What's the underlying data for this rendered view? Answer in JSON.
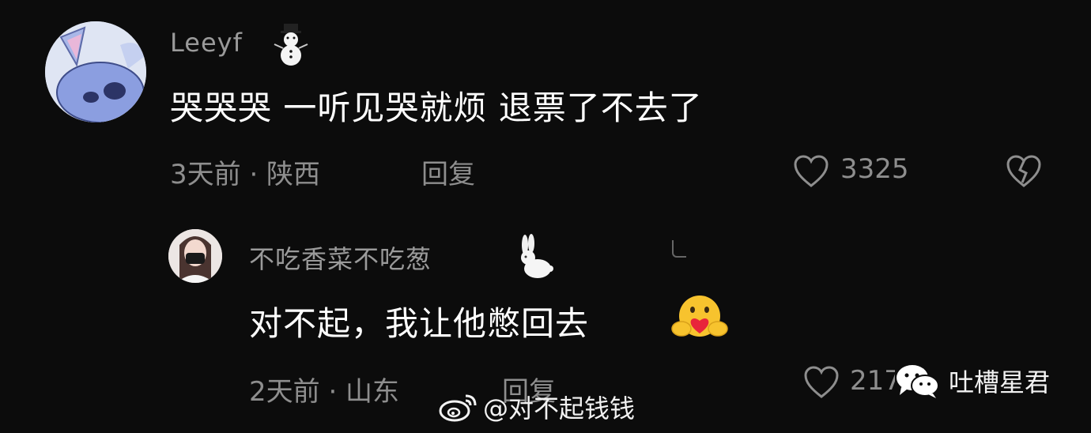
{
  "comment": {
    "username": "Leeyf",
    "username_emoji": "snowman-emoji",
    "text": "哭哭哭 一听见哭就烦 退票了不去了",
    "time": "3天前 · 陕西",
    "reply_label": "回复",
    "like_count": "3325"
  },
  "reply": {
    "username": "不吃香菜不吃葱",
    "username_emoji": "rabbit-emoji",
    "text": "对不起，我让他憋回去",
    "text_emoji": "hugging-face-heart-emoji",
    "time": "2天前 · 山东",
    "reply_label": "回复",
    "like_count": "217"
  },
  "watermarks": {
    "weibo": "@对不起钱钱",
    "wechat": "吐槽星君"
  },
  "colors": {
    "background": "#0c0c0c",
    "meta_text": "#8e8e8e",
    "username_text": "#9a9a9a",
    "comment_text": "#ffffff"
  }
}
